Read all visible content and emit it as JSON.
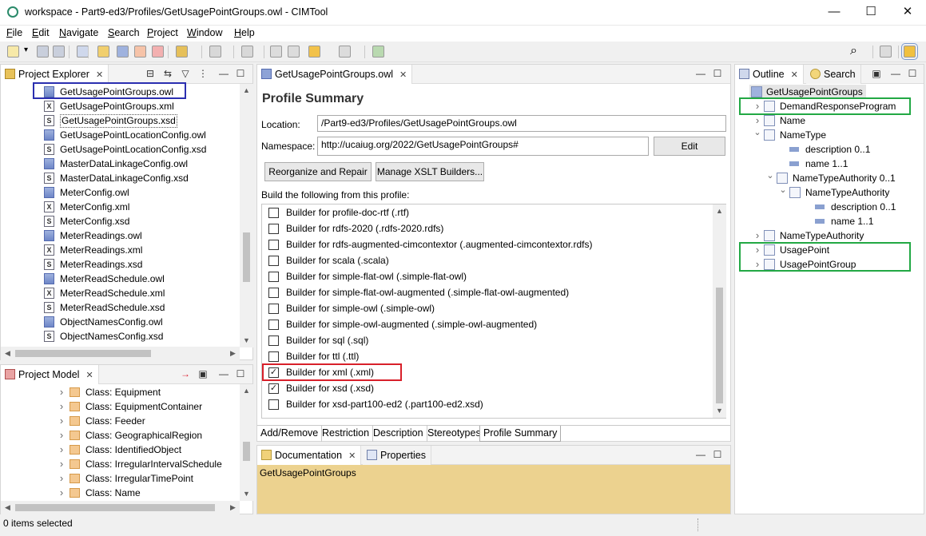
{
  "window": {
    "title": "workspace - Part9-ed3/Profiles/GetUsagePointGroups.owl - CIMTool",
    "minimize": "—",
    "maximize": "☐",
    "close": "✕"
  },
  "menu": [
    {
      "label": "File",
      "accel": "F",
      "rest": "ile"
    },
    {
      "label": "Edit",
      "accel": "E",
      "rest": "dit"
    },
    {
      "label": "Navigate",
      "accel": "N",
      "rest": "avigate"
    },
    {
      "label": "Search",
      "accel": "S",
      "rest": "earch"
    },
    {
      "label": "Project",
      "accel": "P",
      "rest": "roject"
    },
    {
      "label": "Window",
      "accel": "W",
      "rest": "indow"
    },
    {
      "label": "Help",
      "accel": "H",
      "rest": "elp"
    }
  ],
  "project_explorer": {
    "tab_label": "Project Explorer",
    "files": [
      {
        "name": "GetUsagePointGroups.owl",
        "type": "owl"
      },
      {
        "name": "GetUsagePointGroups.xml",
        "type": "xml"
      },
      {
        "name": "GetUsagePointGroups.xsd",
        "type": "xsd"
      },
      {
        "name": "GetUsagePointLocationConfig.owl",
        "type": "owl"
      },
      {
        "name": "GetUsagePointLocationConfig.xsd",
        "type": "xsd"
      },
      {
        "name": "MasterDataLinkageConfig.owl",
        "type": "owl"
      },
      {
        "name": "MasterDataLinkageConfig.xsd",
        "type": "xsd"
      },
      {
        "name": "MeterConfig.owl",
        "type": "owl"
      },
      {
        "name": "MeterConfig.xml",
        "type": "xml"
      },
      {
        "name": "MeterConfig.xsd",
        "type": "xsd"
      },
      {
        "name": "MeterReadings.owl",
        "type": "owl"
      },
      {
        "name": "MeterReadings.xml",
        "type": "xml"
      },
      {
        "name": "MeterReadings.xsd",
        "type": "xsd"
      },
      {
        "name": "MeterReadSchedule.owl",
        "type": "owl"
      },
      {
        "name": "MeterReadSchedule.xml",
        "type": "xml"
      },
      {
        "name": "MeterReadSchedule.xsd",
        "type": "xsd"
      },
      {
        "name": "ObjectNamesConfig.owl",
        "type": "owl"
      },
      {
        "name": "ObjectNamesConfig.xsd",
        "type": "xsd"
      }
    ]
  },
  "project_model": {
    "tab_label": "Project Model",
    "classes": [
      "Class: Equipment",
      "Class: EquipmentContainer",
      "Class: Feeder",
      "Class: GeographicalRegion",
      "Class: IdentifiedObject",
      "Class: IrregularIntervalSchedule",
      "Class: IrregularTimePoint",
      "Class: Name"
    ]
  },
  "editor": {
    "tab_label": "GetUsagePointGroups.owl",
    "heading": "Profile Summary",
    "location_label": "Location:",
    "location_value": "/Part9-ed3/Profiles/GetUsagePointGroups.owl",
    "namespace_label": "Namespace:",
    "namespace_value": "http://ucaiug.org/2022/GetUsagePointGroups#",
    "edit_button": "Edit",
    "reorganize_button": "Reorganize and Repair",
    "manage_xslt_button": "Manage XSLT Builders...",
    "builders_label": "Build the following from this profile:",
    "builders": [
      {
        "label": "Builder for profile-doc-rtf  (.rtf)",
        "checked": false
      },
      {
        "label": "Builder for rdfs-2020  (.rdfs-2020.rdfs)",
        "checked": false
      },
      {
        "label": "Builder for rdfs-augmented-cimcontextor  (.augmented-cimcontextor.rdfs)",
        "checked": false
      },
      {
        "label": "Builder for scala  (.scala)",
        "checked": false
      },
      {
        "label": "Builder for simple-flat-owl  (.simple-flat-owl)",
        "checked": false
      },
      {
        "label": "Builder for simple-flat-owl-augmented  (.simple-flat-owl-augmented)",
        "checked": false
      },
      {
        "label": "Builder for simple-owl  (.simple-owl)",
        "checked": false
      },
      {
        "label": "Builder for simple-owl-augmented  (.simple-owl-augmented)",
        "checked": false
      },
      {
        "label": "Builder for sql  (.sql)",
        "checked": false
      },
      {
        "label": "Builder for ttl  (.ttl)",
        "checked": false
      },
      {
        "label": "Builder for xml  (.xml)",
        "checked": true
      },
      {
        "label": "Builder for xsd  (.xsd)",
        "checked": true
      },
      {
        "label": "Builder for xsd-part100-ed2  (.part100-ed2.xsd)",
        "checked": false
      }
    ],
    "bottom_tabs": [
      "Add/Remove",
      "Restriction",
      "Description",
      "Stereotypes",
      "Profile Summary"
    ]
  },
  "doc_panel": {
    "documentation_tab": "Documentation",
    "properties_tab": "Properties",
    "content": "GetUsagePointGroups"
  },
  "outline": {
    "outline_tab": "Outline",
    "search_tab": "Search",
    "root": "GetUsagePointGroups",
    "nodes": [
      {
        "label": "DemandResponseProgram",
        "indent": 0,
        "arrow": "›",
        "kind": "class"
      },
      {
        "label": "Name",
        "indent": 0,
        "arrow": "›",
        "kind": "class"
      },
      {
        "label": "NameType",
        "indent": 0,
        "arrow": "⌄",
        "kind": "class"
      },
      {
        "label": "description 0..1",
        "indent": 1,
        "arrow": "",
        "kind": "attr"
      },
      {
        "label": "name 1..1",
        "indent": 1,
        "arrow": "",
        "kind": "attr"
      },
      {
        "label": "NameTypeAuthority 0..1",
        "indent": 1,
        "arrow": "⌄",
        "kind": "class"
      },
      {
        "label": "NameTypeAuthority",
        "indent": 2,
        "arrow": "⌄",
        "kind": "class"
      },
      {
        "label": "description 0..1",
        "indent": 3,
        "arrow": "",
        "kind": "attr"
      },
      {
        "label": "name 1..1",
        "indent": 3,
        "arrow": "",
        "kind": "attr"
      },
      {
        "label": "NameTypeAuthority",
        "indent": 0,
        "arrow": "›",
        "kind": "class"
      },
      {
        "label": "UsagePoint",
        "indent": 0,
        "arrow": "›",
        "kind": "class"
      },
      {
        "label": "UsagePointGroup",
        "indent": 0,
        "arrow": "›",
        "kind": "class"
      }
    ]
  },
  "status": {
    "text": "0 items selected"
  },
  "colors": {
    "highlight_blue": "#2b2fb0",
    "highlight_green": "#22a844",
    "highlight_red": "#d8202a",
    "doc_background": "#ecd28f"
  }
}
